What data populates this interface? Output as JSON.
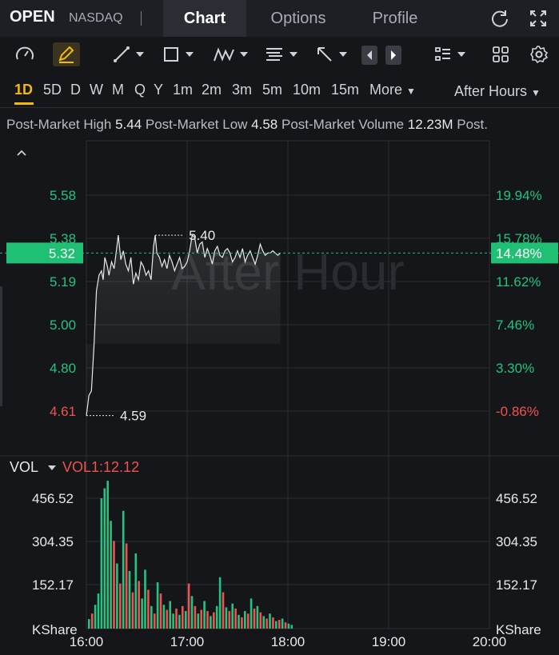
{
  "header": {
    "ticker": "OPEN",
    "exchange": "NASDAQ",
    "tabs": [
      {
        "label": "Chart",
        "active": true
      },
      {
        "label": "Options",
        "active": false
      },
      {
        "label": "Profile",
        "active": false
      }
    ]
  },
  "toolbar": {
    "icons": [
      "speedometer-icon",
      "pencil-icon",
      "trendline-icon",
      "rectangle-icon",
      "pattern-icon",
      "text-icon",
      "arrow-icon",
      "prev-icon",
      "next-icon",
      "list-icon",
      "grid-icon",
      "gear-icon"
    ]
  },
  "periods": {
    "items": [
      "1D",
      "5D",
      "D",
      "W",
      "M",
      "Q",
      "Y",
      "1m",
      "2m",
      "3m",
      "5m",
      "10m",
      "15m"
    ],
    "active": "1D",
    "more_label": "More",
    "session_label": "After Hours"
  },
  "stats": {
    "high_label": "Post-Market High",
    "high_value": "5.44",
    "low_label": "Post-Market Low",
    "low_value": "4.58",
    "volume_label": "Post-Market Volume",
    "volume_value": "12.23M",
    "truncated_label": "Post."
  },
  "colors": {
    "up": "#26c281",
    "down": "#ef5350",
    "current_price_bg": "#1fbf74",
    "background": "#15161a"
  },
  "chart_data": {
    "type": "line",
    "watermark": "After Hour",
    "price_axis_left": [
      "5.58",
      "5.38",
      "5.19",
      "5.00",
      "4.80",
      "4.61"
    ],
    "price_axis_right": [
      "19.94%",
      "15.78%",
      "11.62%",
      "7.46%",
      "3.30%",
      "-0.86%"
    ],
    "current_price": "5.32",
    "current_pct": "14.48%",
    "high_marker": "5.40",
    "low_marker": "4.59",
    "ylim": [
      4.61,
      5.58
    ],
    "x_ticks": [
      "16:00",
      "17:00",
      "18:00",
      "19:00",
      "20:00"
    ],
    "price_series": [
      [
        0,
        4.59
      ],
      [
        3,
        4.68
      ],
      [
        6,
        4.7
      ],
      [
        9,
        4.9
      ],
      [
        12,
        5.15
      ],
      [
        15,
        5.22
      ],
      [
        18,
        5.24
      ],
      [
        20,
        5.2
      ],
      [
        22,
        5.3
      ],
      [
        25,
        5.26
      ],
      [
        27,
        5.22
      ],
      [
        30,
        5.28
      ],
      [
        33,
        5.25
      ],
      [
        35,
        5.31
      ],
      [
        38,
        5.4
      ],
      [
        41,
        5.29
      ],
      [
        44,
        5.33
      ],
      [
        47,
        5.27
      ],
      [
        50,
        5.24
      ],
      [
        53,
        5.3
      ],
      [
        56,
        5.18
      ],
      [
        59,
        5.23
      ],
      [
        62,
        5.2
      ],
      [
        65,
        5.28
      ],
      [
        68,
        5.26
      ],
      [
        71,
        5.22
      ],
      [
        74,
        5.24
      ],
      [
        77,
        5.2
      ],
      [
        80,
        5.35
      ],
      [
        82,
        5.4
      ],
      [
        84,
        5.32
      ],
      [
        87,
        5.3
      ],
      [
        90,
        5.26
      ],
      [
        93,
        5.29
      ],
      [
        96,
        5.25
      ],
      [
        99,
        5.31
      ],
      [
        102,
        5.28
      ],
      [
        105,
        5.24
      ],
      [
        108,
        5.27
      ],
      [
        111,
        5.3
      ],
      [
        114,
        5.25
      ],
      [
        117,
        5.26
      ],
      [
        120,
        5.28
      ],
      [
        123,
        5.33
      ],
      [
        126,
        5.4
      ],
      [
        129,
        5.39
      ],
      [
        132,
        5.32
      ],
      [
        135,
        5.36
      ],
      [
        138,
        5.37
      ],
      [
        141,
        5.3
      ],
      [
        144,
        5.34
      ],
      [
        147,
        5.31
      ],
      [
        150,
        5.27
      ],
      [
        153,
        5.33
      ],
      [
        156,
        5.35
      ],
      [
        159,
        5.31
      ],
      [
        162,
        5.3
      ],
      [
        165,
        5.33
      ],
      [
        168,
        5.34
      ],
      [
        171,
        5.32
      ],
      [
        174,
        5.28
      ],
      [
        177,
        5.3
      ],
      [
        180,
        5.33
      ],
      [
        183,
        5.3
      ],
      [
        186,
        5.34
      ],
      [
        189,
        5.28
      ],
      [
        192,
        5.31
      ],
      [
        195,
        5.33
      ],
      [
        198,
        5.3
      ],
      [
        201,
        5.27
      ],
      [
        204,
        5.31
      ],
      [
        207,
        5.36
      ],
      [
        210,
        5.33
      ],
      [
        213,
        5.31
      ],
      [
        216,
        5.32
      ],
      [
        219,
        5.32
      ],
      [
        222,
        5.33
      ],
      [
        225,
        5.32
      ],
      [
        228,
        5.31
      ],
      [
        231,
        5.32
      ]
    ],
    "volume_panel": {
      "title": "VOL",
      "indicator": "VOL1:12.12",
      "axis_labels": [
        "456.52",
        "304.35",
        "152.17"
      ],
      "unit_label": "KShare",
      "ylim": [
        0,
        600
      ],
      "volumes": [
        {
          "v": 38,
          "up": true
        },
        {
          "v": 60,
          "up": false
        },
        {
          "v": 95,
          "up": true
        },
        {
          "v": 140,
          "up": true
        },
        {
          "v": 520,
          "up": true
        },
        {
          "v": 560,
          "up": true
        },
        {
          "v": 590,
          "up": true
        },
        {
          "v": 430,
          "up": true
        },
        {
          "v": 350,
          "up": false
        },
        {
          "v": 260,
          "up": true
        },
        {
          "v": 180,
          "up": false
        },
        {
          "v": 470,
          "up": true
        },
        {
          "v": 340,
          "up": false
        },
        {
          "v": 230,
          "up": true
        },
        {
          "v": 145,
          "up": false
        },
        {
          "v": 300,
          "up": true
        },
        {
          "v": 190,
          "up": false
        },
        {
          "v": 120,
          "up": true
        },
        {
          "v": 235,
          "up": true
        },
        {
          "v": 155,
          "up": false
        },
        {
          "v": 90,
          "up": true
        },
        {
          "v": 60,
          "up": false
        },
        {
          "v": 185,
          "up": true
        },
        {
          "v": 140,
          "up": false
        },
        {
          "v": 95,
          "up": true
        },
        {
          "v": 75,
          "up": false
        },
        {
          "v": 110,
          "up": true
        },
        {
          "v": 60,
          "up": true
        },
        {
          "v": 80,
          "up": false
        },
        {
          "v": 55,
          "up": true
        },
        {
          "v": 90,
          "up": false
        },
        {
          "v": 70,
          "up": true
        },
        {
          "v": 180,
          "up": false
        },
        {
          "v": 130,
          "up": true
        },
        {
          "v": 90,
          "up": false
        },
        {
          "v": 60,
          "up": true
        },
        {
          "v": 75,
          "up": false
        },
        {
          "v": 110,
          "up": true
        },
        {
          "v": 70,
          "up": false
        },
        {
          "v": 50,
          "up": true
        },
        {
          "v": 65,
          "up": false
        },
        {
          "v": 90,
          "up": true
        },
        {
          "v": 205,
          "up": true
        },
        {
          "v": 145,
          "up": false
        },
        {
          "v": 85,
          "up": true
        },
        {
          "v": 70,
          "up": false
        },
        {
          "v": 100,
          "up": true
        },
        {
          "v": 80,
          "up": false
        },
        {
          "v": 55,
          "up": true
        },
        {
          "v": 45,
          "up": false
        },
        {
          "v": 70,
          "up": true
        },
        {
          "v": 60,
          "up": false
        },
        {
          "v": 120,
          "up": true
        },
        {
          "v": 80,
          "up": false
        },
        {
          "v": 90,
          "up": true
        },
        {
          "v": 65,
          "up": false
        },
        {
          "v": 50,
          "up": true
        },
        {
          "v": 40,
          "up": false
        },
        {
          "v": 60,
          "up": true
        },
        {
          "v": 45,
          "up": false
        },
        {
          "v": 30,
          "up": true
        },
        {
          "v": 35,
          "up": false
        },
        {
          "v": 40,
          "up": true
        },
        {
          "v": 25,
          "up": false
        },
        {
          "v": 20,
          "up": true
        },
        {
          "v": 15,
          "up": true
        }
      ]
    }
  }
}
